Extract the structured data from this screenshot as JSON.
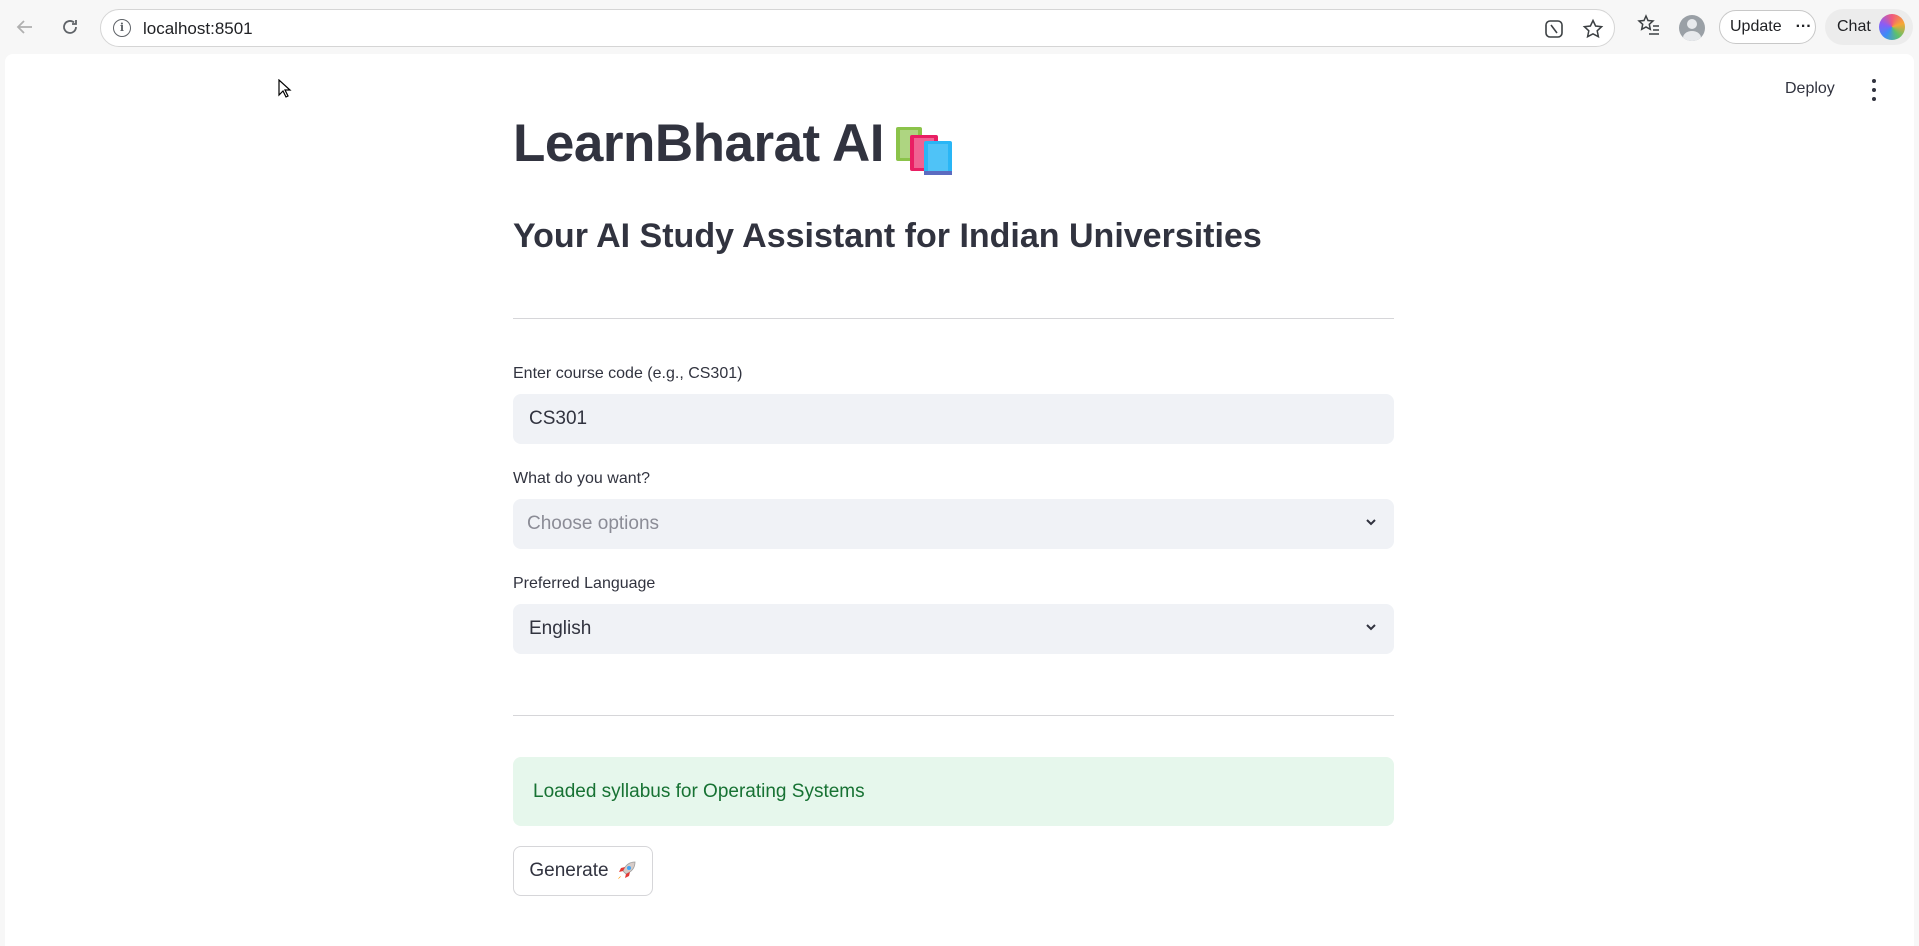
{
  "browser": {
    "url": "localhost:8501",
    "update_label": "Update",
    "more_label": "···",
    "chat_label": "Chat"
  },
  "app": {
    "deploy_label": "Deploy",
    "title": "LearnBharat AI",
    "subtitle": "Your AI Study Assistant for Indian Universities",
    "course_code": {
      "label": "Enter course code (e.g., CS301)",
      "value": "CS301"
    },
    "want": {
      "label": "What do you want?",
      "placeholder": "Choose options"
    },
    "language": {
      "label": "Preferred Language",
      "selected": "English"
    },
    "status_message": "Loaded syllabus for Operating Systems",
    "generate_label": "Generate",
    "generate_emoji": "🚀"
  },
  "colors": {
    "success_bg": "#e6f7ec",
    "success_text": "#177233",
    "field_bg": "#f0f2f6"
  }
}
